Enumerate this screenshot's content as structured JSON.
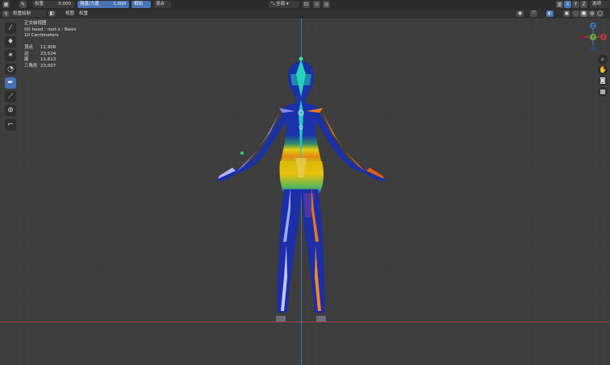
{
  "topbar": {
    "mode_icon": "paint-brush-icon",
    "weight_label": "权重",
    "weight_value": "0.000",
    "radius_label": "强度/力度",
    "radius_value": "1.000",
    "add_label": "相加",
    "blend_label": "混合",
    "orientation": "全局",
    "options_label": "选项"
  },
  "subbar": {
    "mode_label": "权重绘制",
    "view_label": "视图",
    "weights_label": "权重"
  },
  "overlay": {
    "line1": "正交前视图",
    "line2": "(0) head : root.x : Basis",
    "line3": "10 Centimeters"
  },
  "stats": [
    {
      "key": "顶点",
      "value": "11,906"
    },
    {
      "key": "边",
      "value": "23,524"
    },
    {
      "key": "面",
      "value": "11,613"
    },
    {
      "key": "三角形",
      "value": "23,007"
    }
  ],
  "tools": [
    "brush-icon",
    "drop-icon",
    "smear-icon",
    "blur-icon",
    "eyedropper-icon",
    "line-icon",
    "cursor-icon",
    "measure-icon"
  ],
  "gizmo": {
    "z": "Z",
    "y": "Y",
    "x": "X"
  },
  "colors": {
    "viewport_bg": "#3d3d3d",
    "header_bg": "#2b2b2b",
    "accent": "#4772b3",
    "grid_major": "#4a4a4a",
    "x_axis": "#a8404a",
    "y_axis": "#3f74b0",
    "weight_low": "#1b2fa6",
    "weight_high": "#e85d0a"
  }
}
